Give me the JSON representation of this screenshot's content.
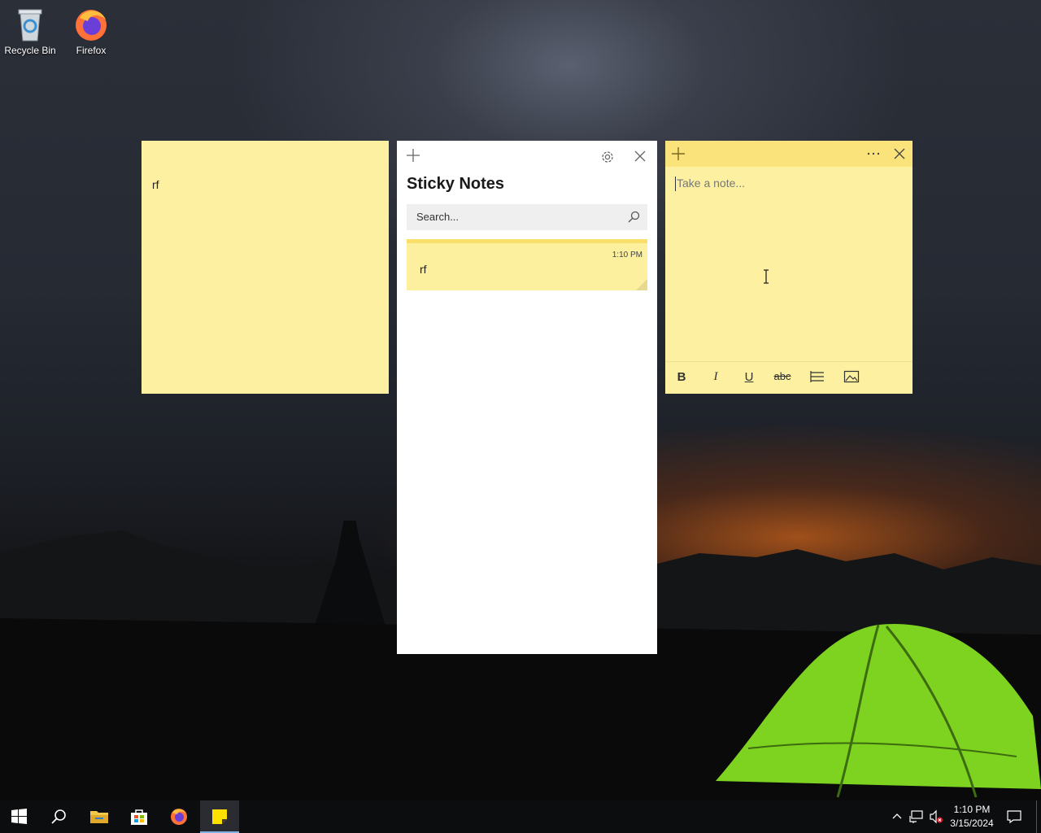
{
  "desktop": {
    "icons": [
      {
        "label": "Recycle Bin"
      },
      {
        "label": "Firefox"
      }
    ]
  },
  "left_note": {
    "text": "rf"
  },
  "list_window": {
    "title": "Sticky Notes",
    "search_placeholder": "Search...",
    "notes": [
      {
        "time": "1:10 PM",
        "text": "rf"
      }
    ]
  },
  "new_note": {
    "placeholder": "Take a note...",
    "toolbar": {
      "bold": "B",
      "italic": "I",
      "underline": "U",
      "strikethrough": "abc"
    }
  },
  "taskbar": {
    "time": "1:10 PM",
    "date": "3/15/2024"
  },
  "colors": {
    "note_yellow": "#fdf0a0",
    "note_bar": "#f9e37a",
    "accent": "#7fb2e3"
  }
}
